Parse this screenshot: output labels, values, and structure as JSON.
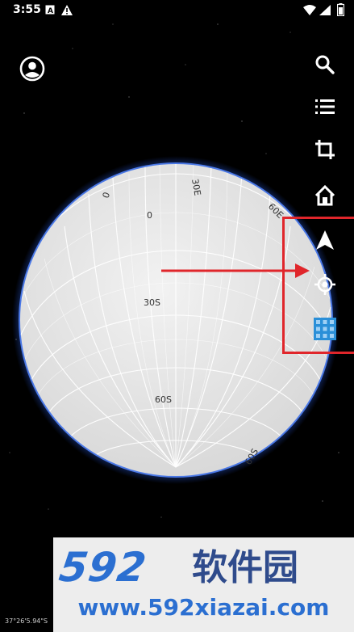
{
  "status_bar": {
    "time": "3:55"
  },
  "globe": {
    "labels": [
      "0",
      "30E",
      "0",
      "60E",
      "30S",
      "60S",
      "60S"
    ]
  },
  "toolbar": {
    "icons": [
      "account-icon",
      "search-icon",
      "list-icon",
      "crop-icon",
      "home-icon",
      "navigation-icon",
      "my-location-icon",
      "grid-layer-icon"
    ]
  },
  "coordinates": "37°26'5.94\"S",
  "watermark": {
    "logo": "592",
    "chinese": "软件园",
    "url": "www.592xiazai.com"
  },
  "colors": {
    "highlight": "#e0262b",
    "watermark_blue": "#2b6fd1",
    "globe_fill": "#e8e8e8",
    "globe_glow": "#2f63d8"
  }
}
